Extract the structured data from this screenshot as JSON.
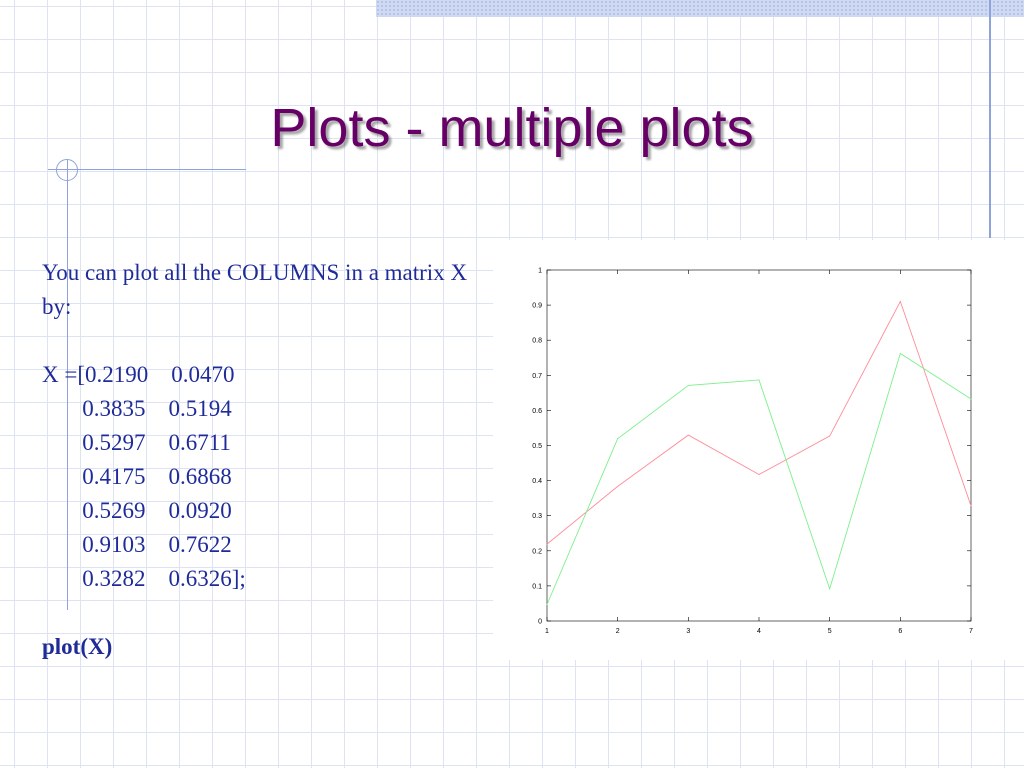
{
  "title": "Plots - multiple plots",
  "body": {
    "intro": "You can plot all the COLUMNS in a matrix X by:",
    "matrix_lines": [
      "X =[0.2190    0.0470",
      "       0.3835    0.5194",
      "       0.5297    0.6711",
      "       0.4175    0.6868",
      "       0.5269    0.0920",
      "       0.9103    0.7622",
      "       0.3282    0.6326];"
    ],
    "command": "plot(X)"
  },
  "chart_data": {
    "type": "line",
    "title": "",
    "xlabel": "",
    "ylabel": "",
    "x": [
      1,
      2,
      3,
      4,
      5,
      6,
      7
    ],
    "series": [
      {
        "values": [
          0.219,
          0.3835,
          0.5297,
          0.4175,
          0.5269,
          0.9103,
          0.3282
        ],
        "color": "#ff8c99"
      },
      {
        "values": [
          0.047,
          0.5194,
          0.6711,
          0.6868,
          0.092,
          0.7622,
          0.6326
        ],
        "color": "#7cf08c"
      }
    ],
    "xlim": [
      1,
      7
    ],
    "ylim": [
      0,
      1
    ],
    "x_ticks": [
      "1",
      "2",
      "3",
      "4",
      "5",
      "6",
      "7"
    ],
    "y_ticks": [
      "0",
      "0.1",
      "0.2",
      "0.3",
      "0.4",
      "0.5",
      "0.6",
      "0.7",
      "0.8",
      "0.9",
      "1"
    ],
    "grid": false,
    "legend": "none"
  }
}
